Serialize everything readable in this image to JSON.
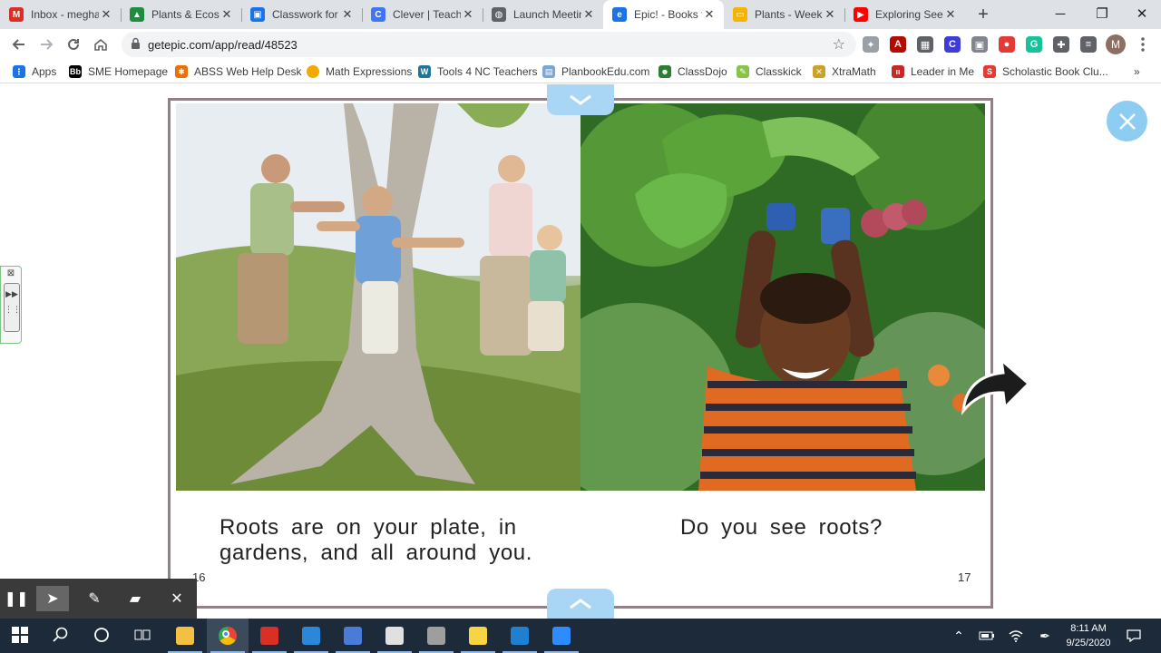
{
  "tabs": [
    {
      "title": "Inbox - megha",
      "icon": "gmail-icon",
      "color": "#d93025",
      "glyph": "M",
      "active": false
    },
    {
      "title": "Plants & Ecosy",
      "icon": "google-drive-icon",
      "color": "#1e8e3e",
      "glyph": "▲",
      "active": false
    },
    {
      "title": "Classwork for",
      "icon": "classroom-icon",
      "color": "#1a73e8",
      "glyph": "▣",
      "active": false
    },
    {
      "title": "Clever | Teache",
      "icon": "clever-icon",
      "color": "#4274f6",
      "glyph": "C",
      "active": false
    },
    {
      "title": "Launch Meetin",
      "icon": "globe-icon",
      "color": "#5f6368",
      "glyph": "◍",
      "active": false
    },
    {
      "title": "Epic! - Books f",
      "icon": "epic-icon",
      "color": "#1a73e8",
      "glyph": "e",
      "active": true
    },
    {
      "title": "Plants - Week",
      "icon": "slides-icon",
      "color": "#f4b400",
      "glyph": "▭",
      "active": false
    },
    {
      "title": "Exploring Seec",
      "icon": "youtube-icon",
      "color": "#ff0000",
      "glyph": "▶",
      "active": false
    }
  ],
  "window": {
    "minimize": "─",
    "restore": "❐",
    "close": "✕",
    "new_tab": "+"
  },
  "toolbar": {
    "url": "getepic.com/app/read/48523",
    "avatar_letter": "M"
  },
  "extensions": [
    {
      "name": "ext-puzzle-gray-icon",
      "color": "#9aa0a6",
      "glyph": "✦"
    },
    {
      "name": "ext-acrobat-icon",
      "color": "#b30b00",
      "glyph": "A"
    },
    {
      "name": "ext-grid-icon",
      "color": "#5f6368",
      "glyph": "▦"
    },
    {
      "name": "ext-clever-icon",
      "color": "#3c3cd6",
      "glyph": "C"
    },
    {
      "name": "ext-screencast-icon",
      "color": "#80868b",
      "glyph": "▣"
    },
    {
      "name": "ext-record-icon",
      "color": "#e53935",
      "glyph": "●"
    },
    {
      "name": "ext-grammarly-icon",
      "color": "#15c39a",
      "glyph": "G"
    },
    {
      "name": "ext-extensions-icon",
      "color": "#5f6368",
      "glyph": "✚"
    },
    {
      "name": "ext-reading-list-icon",
      "color": "#5f6368",
      "glyph": "≡"
    }
  ],
  "bookmarks": [
    {
      "label": "Apps",
      "icon": "apps-grid-icon",
      "color": "#1a73e8",
      "glyph": "⋮"
    },
    {
      "label": "SME Homepage",
      "icon": "blackboard-icon",
      "color": "#000000",
      "glyph": "Bb"
    },
    {
      "label": "ABSS Web Help Desk",
      "icon": "helpdesk-icon",
      "color": "#e8710a",
      "glyph": "✱"
    },
    {
      "label": "Math Expressions",
      "icon": "circle-icon",
      "color": "#f2a900",
      "glyph": ""
    },
    {
      "label": "Tools 4 NC Teachers",
      "icon": "wordpress-icon",
      "color": "#21759b",
      "glyph": "W"
    },
    {
      "label": "PlanbookEdu.com",
      "icon": "planbook-icon",
      "color": "#7aa7d8",
      "glyph": "▤"
    },
    {
      "label": "ClassDojo",
      "icon": "classdojo-icon",
      "color": "#2e7d32",
      "glyph": "☻"
    },
    {
      "label": "Classkick",
      "icon": "classkick-icon",
      "color": "#8bc34a",
      "glyph": "✎"
    },
    {
      "label": "XtraMath",
      "icon": "xtramath-icon",
      "color": "#c9a227",
      "glyph": "✕"
    },
    {
      "label": "Leader in Me",
      "icon": "leader-icon",
      "color": "#c62828",
      "glyph": "ıı"
    },
    {
      "label": "Scholastic Book Clu...",
      "icon": "scholastic-icon",
      "color": "#e53935",
      "glyph": "S"
    }
  ],
  "book": {
    "left_caption_line1": "Roots are on your plate, in",
    "left_caption_line2": "gardens, and all around you.",
    "right_caption": "Do you see roots?",
    "left_page_number": "16",
    "right_page_number": "17",
    "frame_color": "#8e8288",
    "accent": "#8ecdf2"
  },
  "annotation_tools": [
    {
      "name": "pause-icon",
      "glyph": "❚❚"
    },
    {
      "name": "pointer-icon",
      "glyph": "➤"
    },
    {
      "name": "pen-icon",
      "glyph": "✎"
    },
    {
      "name": "eraser-icon",
      "glyph": "▰"
    },
    {
      "name": "close-tools-icon",
      "glyph": "✕"
    }
  ],
  "side_widget": {
    "label": "⊠"
  },
  "taskbar": {
    "apps": [
      {
        "name": "windows-start-icon",
        "color": "#ffffff"
      },
      {
        "name": "search-icon",
        "color": "#ffffff"
      },
      {
        "name": "cortana-icon",
        "color": "#ffffff"
      },
      {
        "name": "task-view-icon",
        "color": "#ffffff"
      },
      {
        "name": "file-explorer-icon",
        "color": "#f4c042"
      },
      {
        "name": "chrome-icon",
        "color": "#4285f4"
      },
      {
        "name": "mail-icon",
        "color": "#d93025"
      },
      {
        "name": "notes-app-icon",
        "color": "#2b88d8"
      },
      {
        "name": "docs-icon",
        "color": "#4a7bd6"
      },
      {
        "name": "paint-icon",
        "color": "#e0e0e0"
      },
      {
        "name": "calculator-icon",
        "color": "#9e9e9e"
      },
      {
        "name": "sticky-notes-icon",
        "color": "#f7d542"
      },
      {
        "name": "media-player-icon",
        "color": "#1f7fd1"
      },
      {
        "name": "zoom-icon",
        "color": "#2d8cff"
      }
    ],
    "time": "8:11 AM",
    "date": "9/25/2020"
  }
}
